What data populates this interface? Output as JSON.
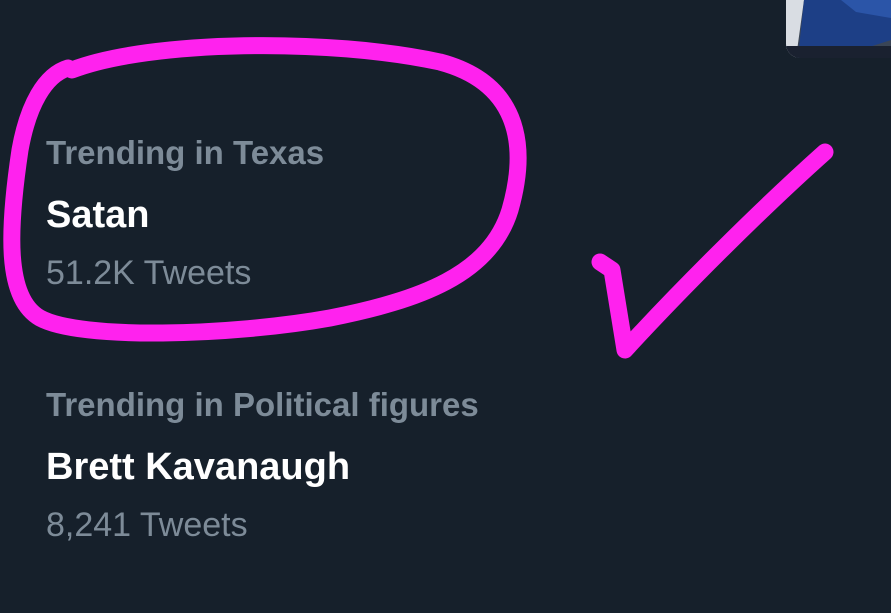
{
  "trends": [
    {
      "context": "Trending in Texas",
      "title": "Satan",
      "count": "51.2K Tweets"
    },
    {
      "context": "Trending in Political figures",
      "title": "Brett Kavanaugh",
      "count": "8,241 Tweets"
    }
  ],
  "colors": {
    "background": "#16202b",
    "secondary_text": "#7d8b98",
    "primary_text": "#ffffff",
    "annotation": "#ff22ee"
  },
  "annotations": {
    "circle": "hand-drawn-circle-around-first-trend",
    "check": "hand-drawn-checkmark"
  }
}
